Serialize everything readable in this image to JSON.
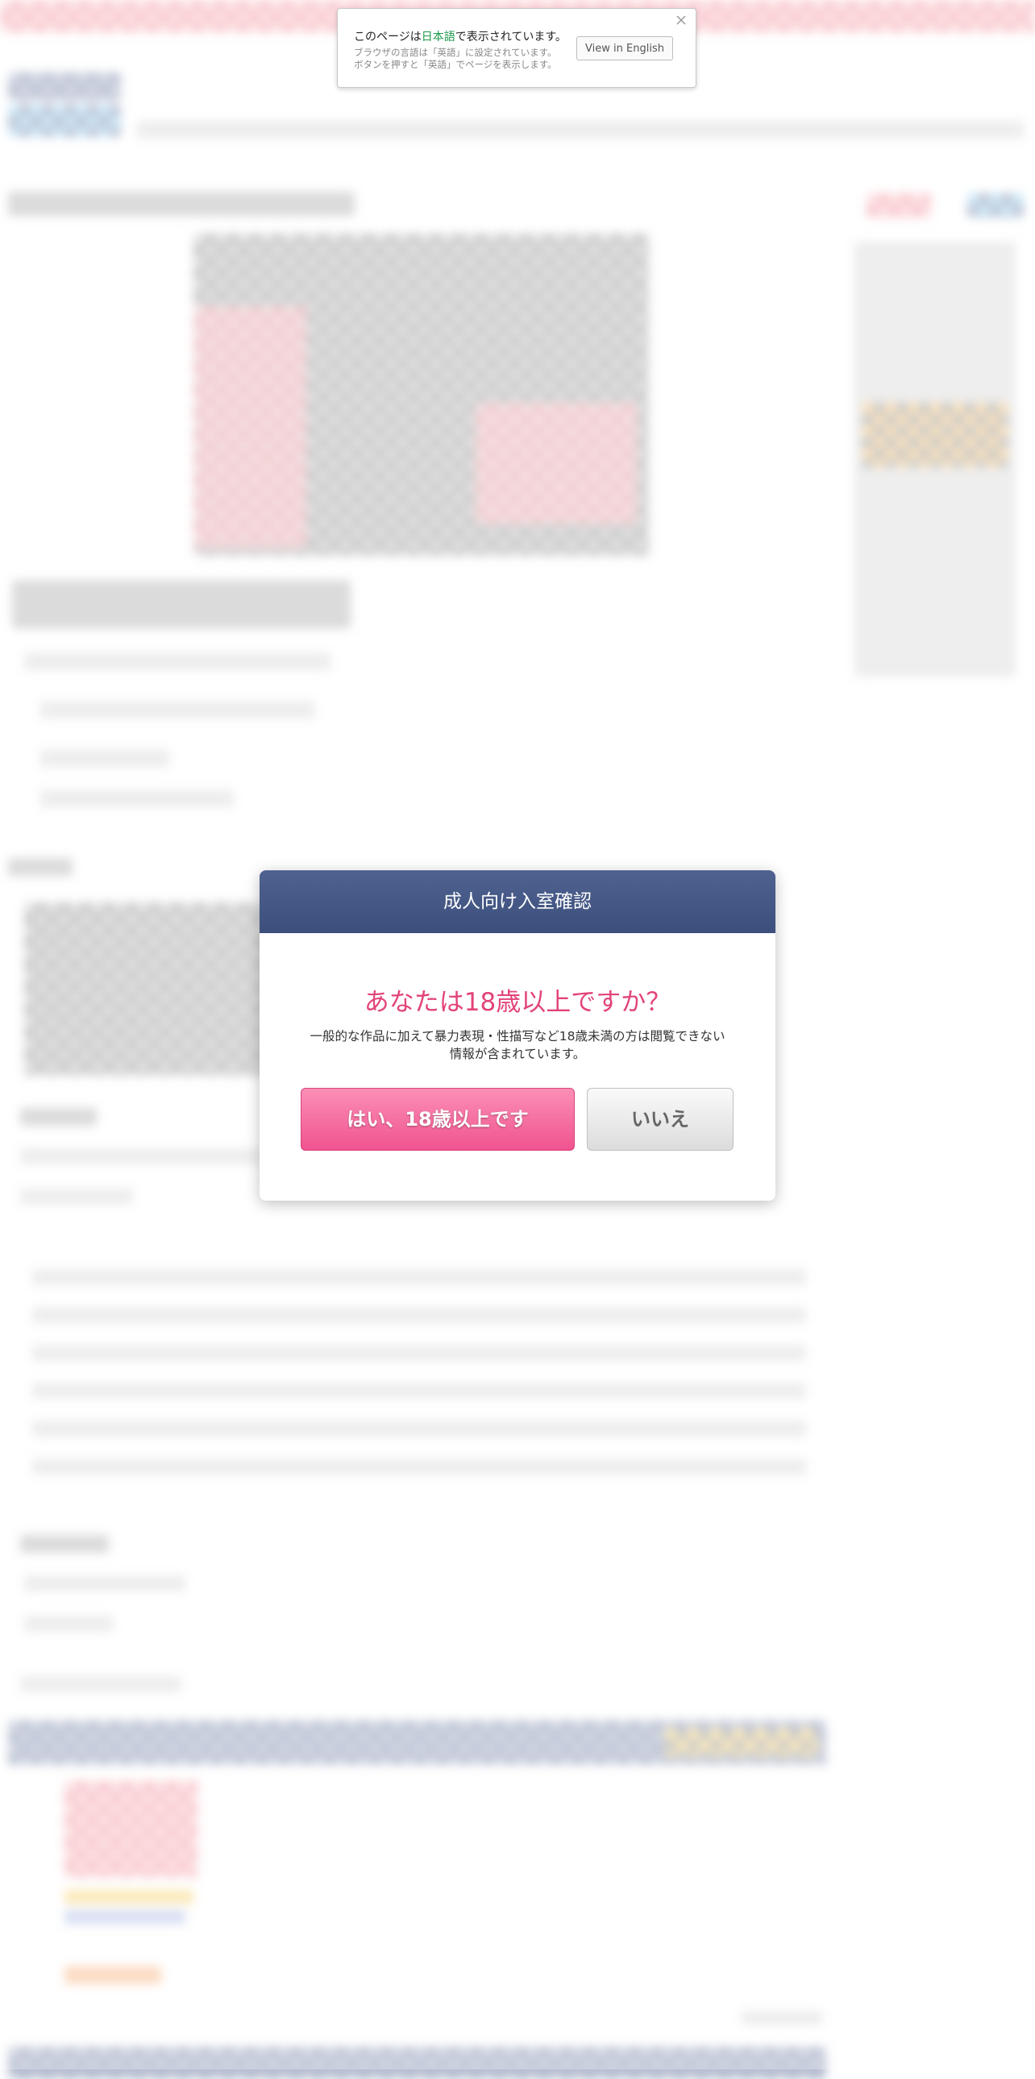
{
  "language_bar": {
    "message_prefix": "このページは",
    "language": "日本語",
    "message_suffix": "で表示されています。",
    "sub_line1": "ブラウザの言語は「英語」に設定されています。",
    "sub_line2": "ボタンを押すと「英語」でページを表示します。",
    "button_label": "View in English",
    "close_icon": "close-icon",
    "highlight_color": "#1a9a4a"
  },
  "age_modal": {
    "title": "成人向け入室確認",
    "question": "あなたは18歳以上ですか？",
    "description": "一般的な作品に加えて暴力表現・性描写など18歳未満の方は閲覧できない情報が含まれています。",
    "yes_label": "はい、18歳以上です",
    "no_label": "いいえ",
    "header_color": "#445888",
    "question_color": "#e2437a",
    "yes_color": "#f0538f"
  }
}
